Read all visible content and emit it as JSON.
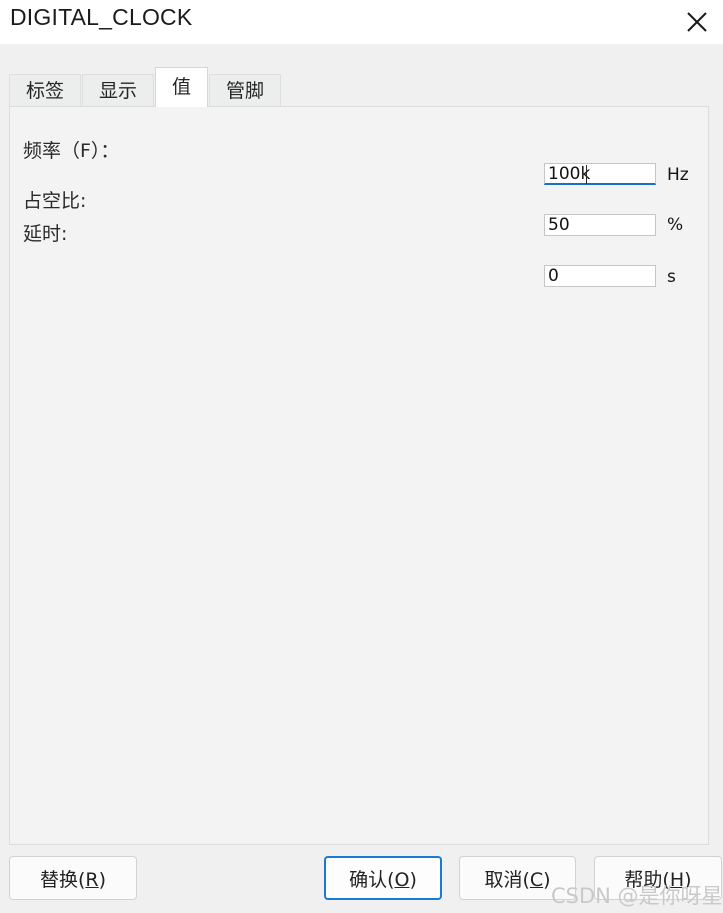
{
  "window": {
    "title": "DIGITAL_CLOCK",
    "close_icon": "close-icon"
  },
  "tabs": [
    {
      "label": "标签",
      "active": false
    },
    {
      "label": "显示",
      "active": false
    },
    {
      "label": "值",
      "active": true
    },
    {
      "label": "管脚",
      "active": false
    }
  ],
  "form": {
    "fields": [
      {
        "label": "频率（F）：",
        "value": "100k",
        "unit": "Hz",
        "focused": true
      },
      {
        "label": "占空比:",
        "value": "50",
        "unit": "%",
        "focused": false
      },
      {
        "label": "延时:",
        "value": "0",
        "unit": "s",
        "focused": false
      }
    ]
  },
  "buttons": {
    "replace": {
      "text": "替换(R)",
      "base": "替换(",
      "key": "R",
      "tail": ")"
    },
    "ok": {
      "text": "确认(O)",
      "base": "确认(",
      "key": "O",
      "tail": ")"
    },
    "cancel": {
      "text": "取消(C)",
      "base": "取消(",
      "key": "C",
      "tail": ")"
    },
    "help": {
      "text": "帮助(H)",
      "base": "帮助(",
      "key": "H",
      "tail": ")"
    }
  },
  "watermark": "CSDN @是你呀星",
  "colors": {
    "accent": "#1a7ad1",
    "focus_underline": "#1a6fc4",
    "dialog_bg": "#f0f0f0",
    "panel_bg": "#f3f3f3",
    "titlebar_bg": "#ffffff"
  }
}
